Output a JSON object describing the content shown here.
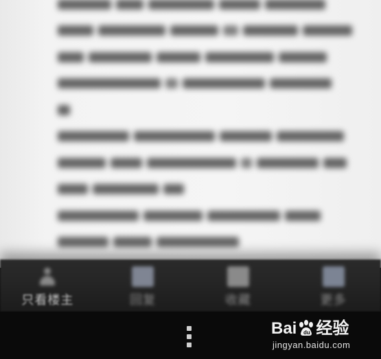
{
  "article": {
    "blurred_lines": 9
  },
  "action_bar": {
    "items": [
      {
        "label": "只看楼主",
        "icon": "person-icon"
      },
      {
        "label": "回复",
        "icon": "reply-icon"
      },
      {
        "label": "收藏",
        "icon": "bookmark-icon"
      },
      {
        "label": "更多",
        "icon": "more-icon"
      }
    ]
  },
  "nav": {
    "overflow_icon": "overflow-menu-icon"
  },
  "watermark": {
    "brand": "Baidu经验",
    "url": "jingyan.baidu.com"
  }
}
